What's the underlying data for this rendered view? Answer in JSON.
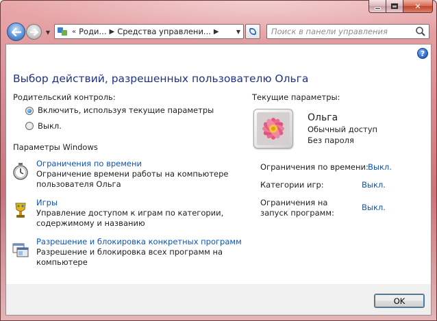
{
  "window": {
    "caption": {
      "minimize": "",
      "maximize": "",
      "close": "✕"
    }
  },
  "nav": {
    "breadcrumb": [
      "Роди...",
      "Средства управлени..."
    ],
    "breadcrumb_prefix": "«",
    "search_placeholder": "Поиск в панели управления"
  },
  "page": {
    "title": "Выбор действий, разрешенных пользователю Ольга",
    "parental_label": "Родительский контроль:",
    "radio_on": "Включить, используя текущие параметры",
    "radio_off": "Выкл.",
    "radio_selected": "on",
    "windows_settings": "Параметры Windows",
    "items": [
      {
        "icon": "clock-icon",
        "link": "Ограничения по времени",
        "desc1": "Ограничение времени работы на компьютере",
        "desc2": "пользователя Ольга"
      },
      {
        "icon": "games-trophy-icon",
        "link": "Игры",
        "desc1": "Управление доступом к играм по категории,",
        "desc2": "содержимому и названию"
      },
      {
        "icon": "programs-icon",
        "link": "Разрешение и блокировка конкретных программ",
        "desc1": "Разрешение и блокировка всех программ на",
        "desc2": "компьютере"
      }
    ]
  },
  "current": {
    "label": "Текущие параметры:",
    "user_name": "Ольга",
    "access": "Обычный доступ",
    "password": "Без пароля",
    "rows": [
      {
        "label": "Ограничения по времени:",
        "value": "Выкл."
      },
      {
        "label": "Категории игр:",
        "value": "Выкл."
      },
      {
        "label1": "Ограничения на",
        "label2": "запуск программ:",
        "value": "Выкл."
      }
    ]
  },
  "footer": {
    "ok_label": "OK"
  },
  "colors": {
    "link": "#0b54b8",
    "title": "#1e3287",
    "frame": "#d98b90"
  }
}
